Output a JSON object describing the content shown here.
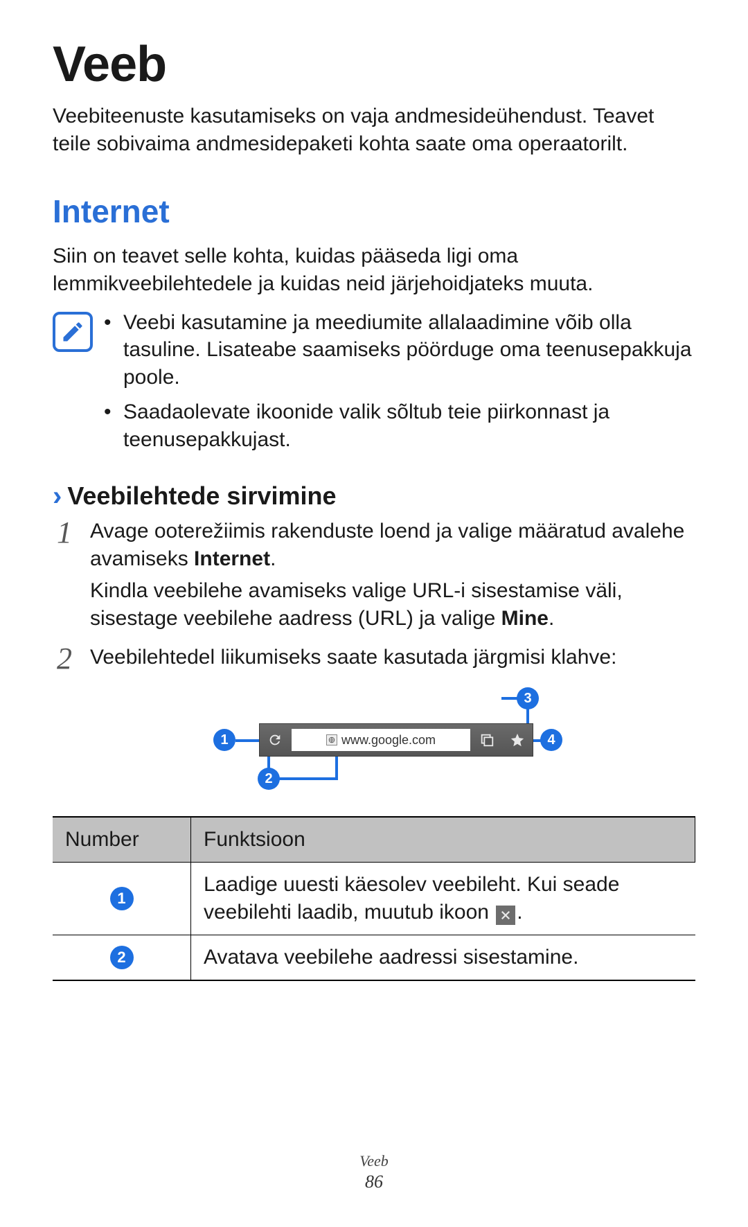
{
  "title": "Veeb",
  "intro": "Veebiteenuste kasutamiseks on vaja andmesideühendust. Teavet teile sobivaima andmesidepaketi kohta saate oma operaatorilt.",
  "section_heading": "Internet",
  "section_text": "Siin on teavet selle kohta, kuidas pääseda ligi oma lemmikveebilehtedele ja kuidas neid järjehoidjateks muuta.",
  "notes": [
    "Veebi kasutamine ja meediumite allalaadimine võib olla tasuline. Lisateabe saamiseks pöörduge oma teenusepakkuja poole.",
    "Saadaolevate ikoonide valik sõltub teie piirkonnast ja teenusepakkujast."
  ],
  "sub_heading": "Veebilehtede sirvimine",
  "steps": {
    "s1": {
      "num": "1",
      "line1_a": "Avage ooterežiimis rakenduste loend ja valige määratud avalehe avamiseks ",
      "line1_bold": "Internet",
      "line1_c": ".",
      "line2_a": "Kindla veebilehe avamiseks valige URL-i sisestamise väli, sisestage veebilehe aadress (URL) ja valige ",
      "line2_bold": "Mine",
      "line2_c": "."
    },
    "s2": {
      "num": "2",
      "text": "Veebilehtedel liikumiseks saate kasutada järgmisi klahve:"
    }
  },
  "diagram": {
    "url_text": "www.google.com",
    "callouts": {
      "c1": "1",
      "c2": "2",
      "c3": "3",
      "c4": "4"
    }
  },
  "table": {
    "head_num": "Number",
    "head_func": "Funktsioon",
    "rows": [
      {
        "num": "1",
        "func_a": "Laadige uuesti käesolev veebileht. Kui seade veebilehti laadib, muutub ikoon ",
        "has_stop_icon": true,
        "func_b": "."
      },
      {
        "num": "2",
        "func_a": "Avatava veebilehe aadressi sisestamine.",
        "has_stop_icon": false,
        "func_b": ""
      }
    ]
  },
  "footer_title": "Veeb",
  "page_number": "86"
}
